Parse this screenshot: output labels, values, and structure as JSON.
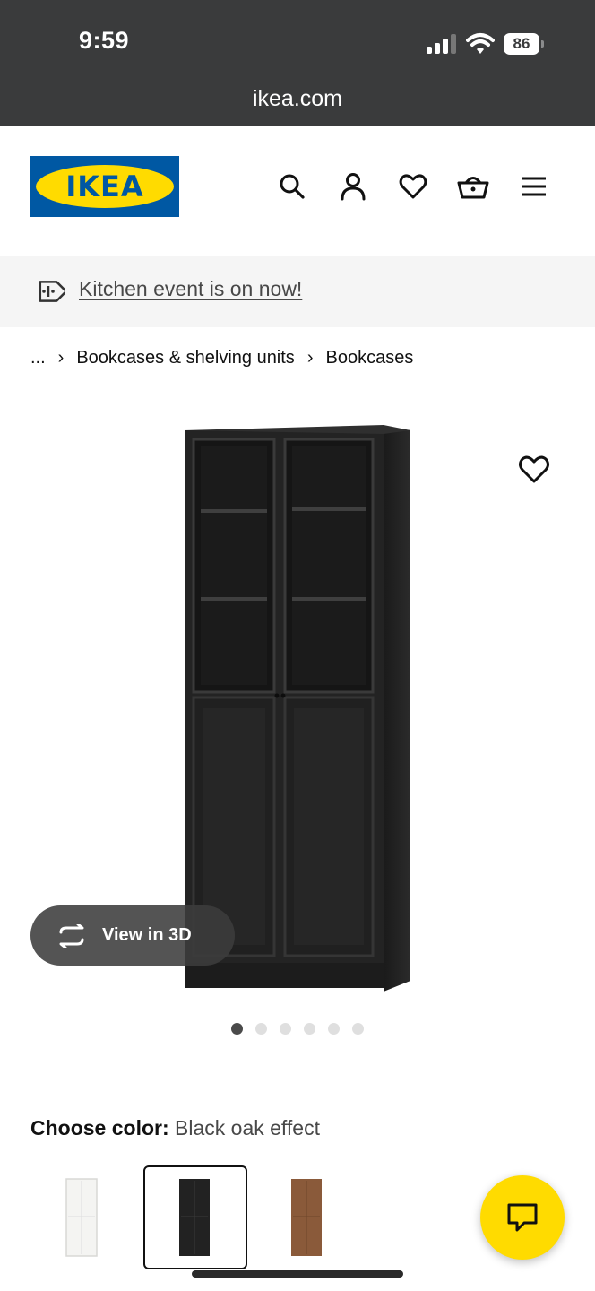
{
  "status_bar": {
    "time": "9:59",
    "battery": "86"
  },
  "browser": {
    "url": "ikea.com"
  },
  "header": {
    "logo_text": "IKEA",
    "icons": [
      "search-icon",
      "account-icon",
      "heart-icon",
      "basket-icon",
      "menu-icon"
    ]
  },
  "promo": {
    "text": "Kitchen event is on now!",
    "icon": "tag-icon"
  },
  "breadcrumb": {
    "ellipsis": "...",
    "items": [
      "Bookcases & shelving units",
      "Bookcases"
    ]
  },
  "product": {
    "view_3d_label": "View in 3D",
    "image_count": 6,
    "active_image_index": 0
  },
  "color_chooser": {
    "label": "Choose color:",
    "value": "Black oak effect",
    "swatches": [
      "white",
      "black-oak",
      "brown"
    ],
    "selected_index": 1
  },
  "colors": {
    "ikea_blue": "#0058a3",
    "ikea_yellow": "#ffdb00",
    "status_bar": "#3a3b3c"
  }
}
